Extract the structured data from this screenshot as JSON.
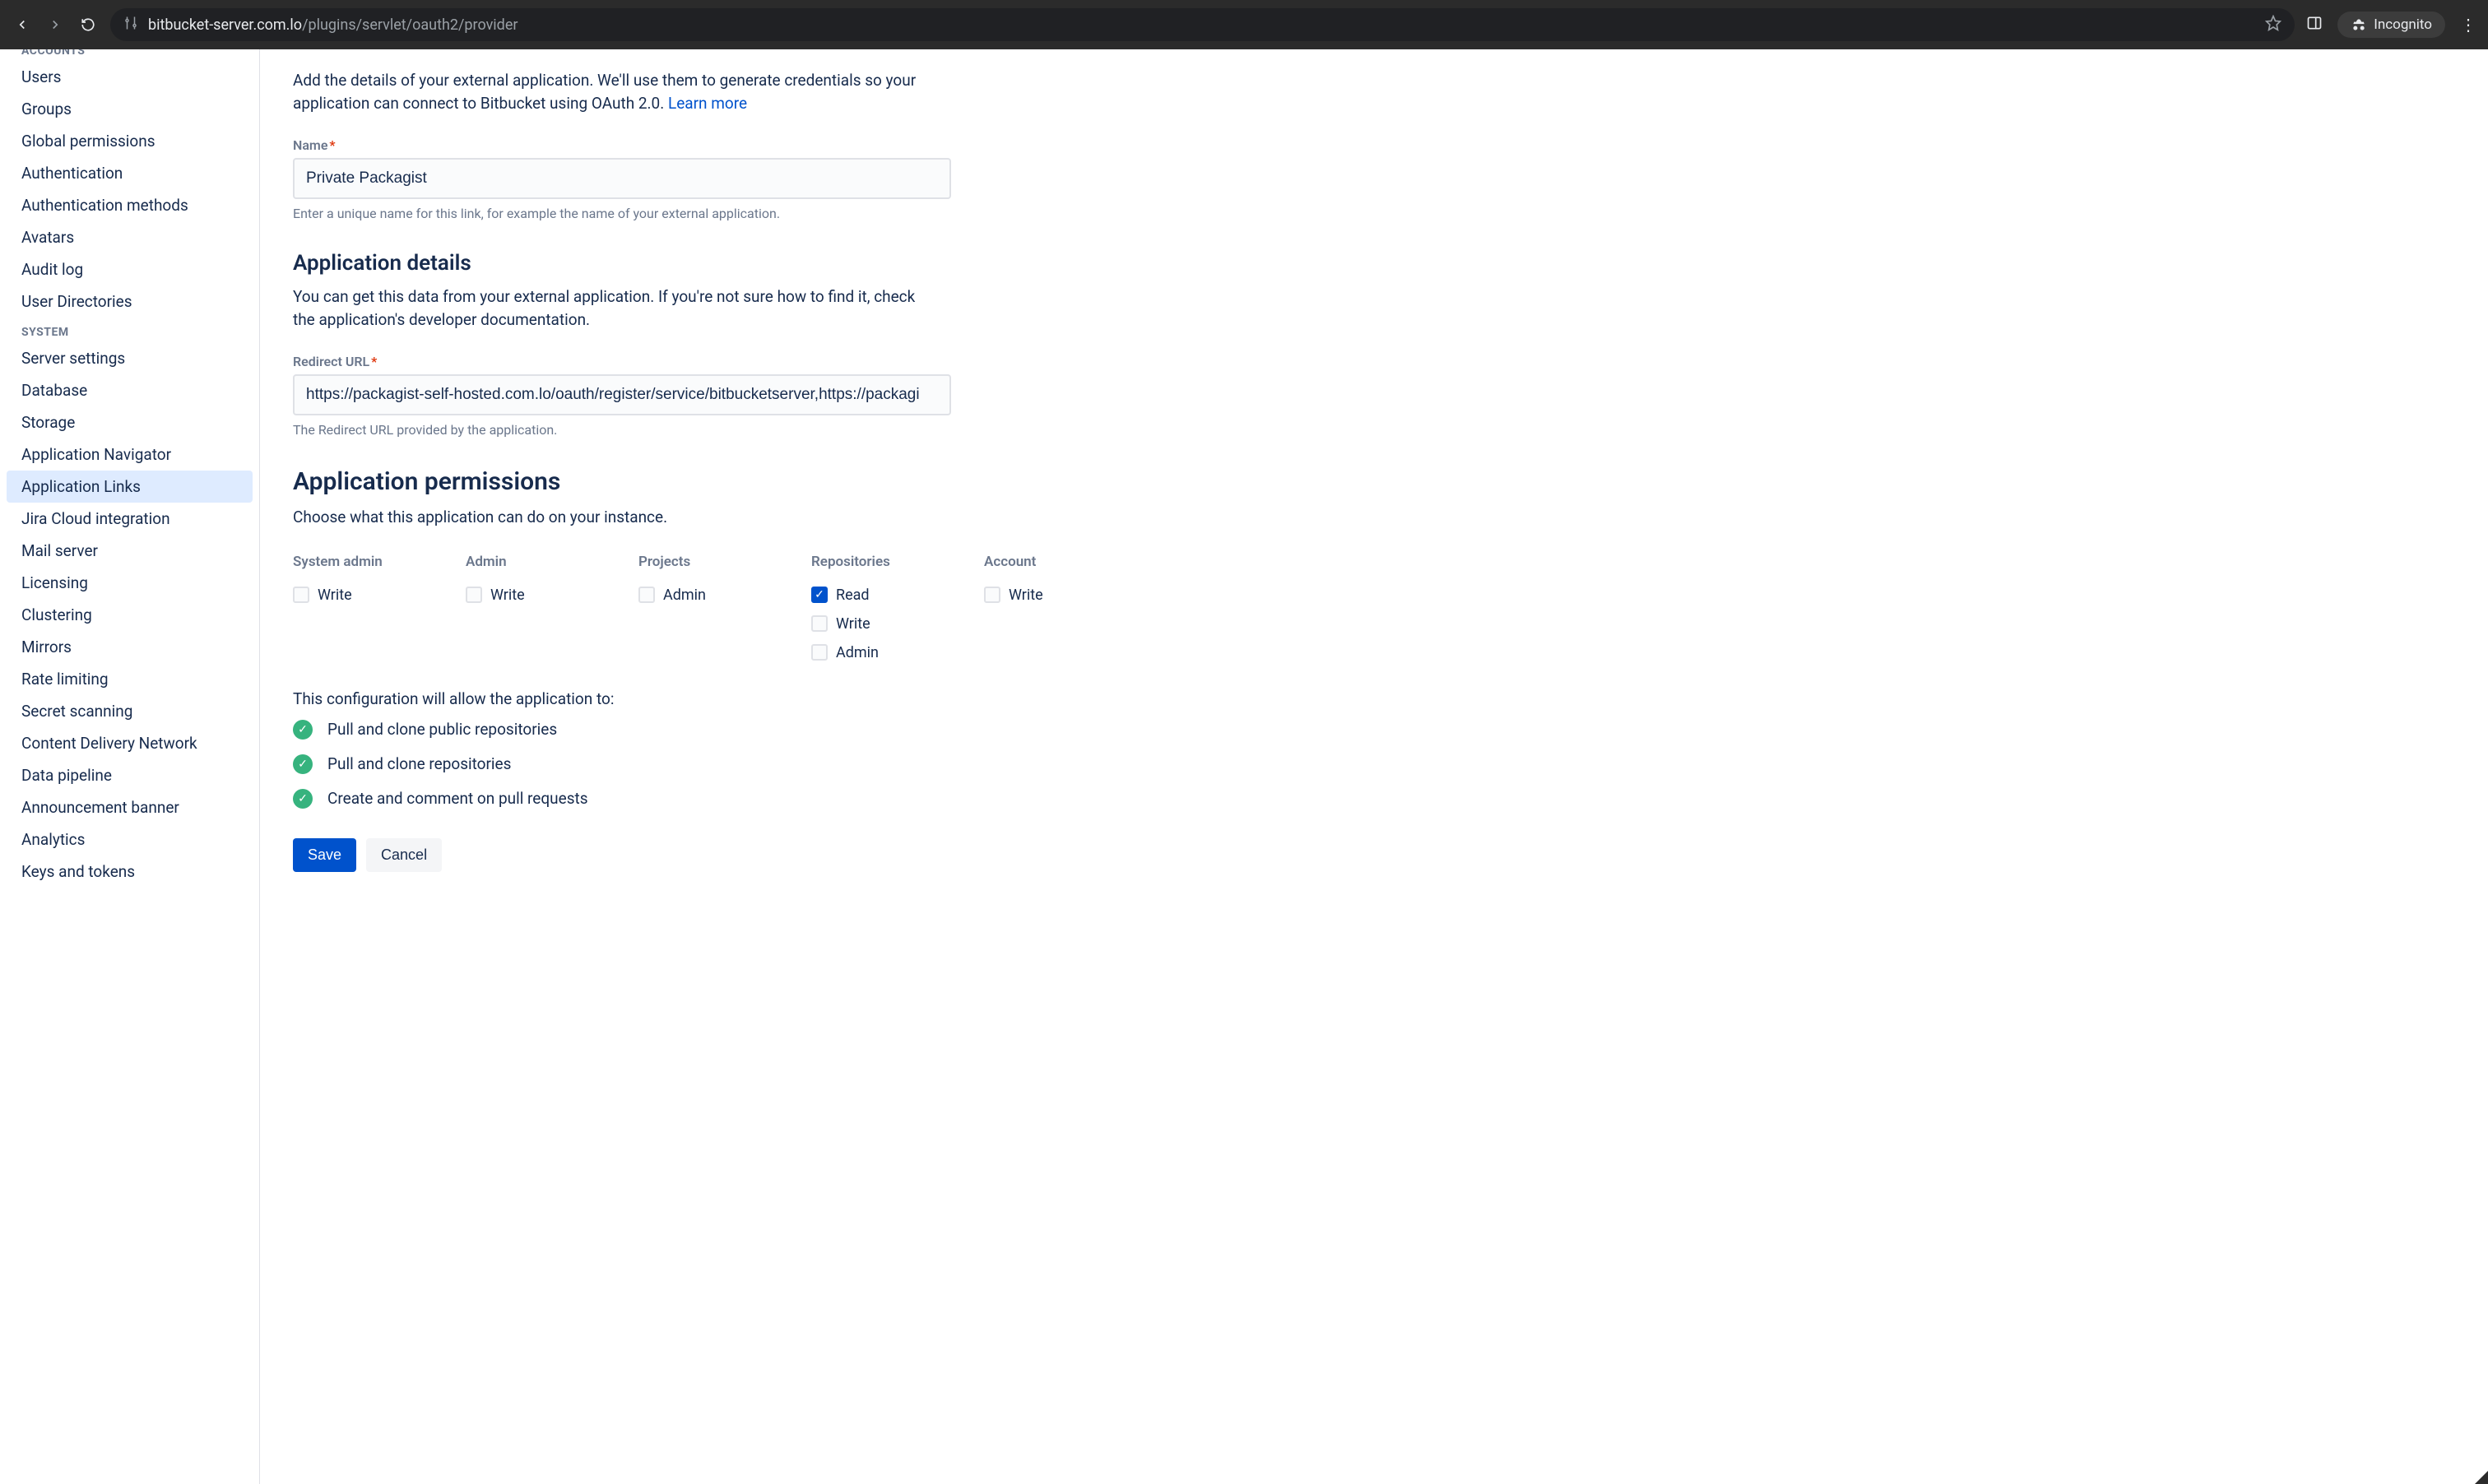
{
  "browser": {
    "url_host": "bitbucket-server.com.lo",
    "url_path": "/plugins/servlet/oauth2/provider",
    "incognito_label": "Incognito"
  },
  "sidebar": {
    "sections": [
      {
        "header": "ACCOUNTS",
        "clipped": true,
        "items": [
          {
            "label": "Users"
          },
          {
            "label": "Groups"
          },
          {
            "label": "Global permissions"
          },
          {
            "label": "Authentication"
          },
          {
            "label": "Authentication methods"
          },
          {
            "label": "Avatars"
          },
          {
            "label": "Audit log"
          },
          {
            "label": "User Directories"
          }
        ]
      },
      {
        "header": "SYSTEM",
        "items": [
          {
            "label": "Server settings"
          },
          {
            "label": "Database"
          },
          {
            "label": "Storage"
          },
          {
            "label": "Application Navigator"
          },
          {
            "label": "Application Links",
            "selected": true
          },
          {
            "label": "Jira Cloud integration"
          },
          {
            "label": "Mail server"
          },
          {
            "label": "Licensing"
          },
          {
            "label": "Clustering"
          },
          {
            "label": "Mirrors"
          },
          {
            "label": "Rate limiting"
          },
          {
            "label": "Secret scanning"
          },
          {
            "label": "Content Delivery Network"
          },
          {
            "label": "Data pipeline"
          },
          {
            "label": "Announcement banner"
          },
          {
            "label": "Analytics"
          },
          {
            "label": "Keys and tokens"
          }
        ]
      }
    ]
  },
  "main": {
    "intro_text": "Add the details of your external application. We'll use them to generate credentials so your application can connect to Bitbucket using OAuth 2.0. ",
    "learn_more": "Learn more",
    "name_field": {
      "label": "Name",
      "value": "Private Packagist",
      "help": "Enter a unique name for this link, for example the name of your external application."
    },
    "app_details": {
      "heading": "Application details",
      "desc": "You can get this data from your external application. If you're not sure how to find it, check the application's developer documentation.",
      "redirect_label": "Redirect URL",
      "redirect_value": "https://packagist-self-hosted.com.lo/oauth/register/service/bitbucketserver,https://packagi",
      "redirect_help": "The Redirect URL provided by the application."
    },
    "permissions": {
      "heading": "Application permissions",
      "desc": "Choose what this application can do on your instance.",
      "columns": [
        {
          "head": "System admin",
          "options": [
            {
              "label": "Write",
              "checked": false
            }
          ]
        },
        {
          "head": "Admin",
          "options": [
            {
              "label": "Write",
              "checked": false
            }
          ]
        },
        {
          "head": "Projects",
          "options": [
            {
              "label": "Admin",
              "checked": false
            }
          ]
        },
        {
          "head": "Repositories",
          "options": [
            {
              "label": "Read",
              "checked": true
            },
            {
              "label": "Write",
              "checked": false
            },
            {
              "label": "Admin",
              "checked": false
            }
          ]
        },
        {
          "head": "Account",
          "options": [
            {
              "label": "Write",
              "checked": false
            }
          ]
        }
      ]
    },
    "capabilities": {
      "intro": "This configuration will allow the application to:",
      "items": [
        "Pull and clone public repositories",
        "Pull and clone repositories",
        "Create and comment on pull requests"
      ]
    },
    "actions": {
      "save": "Save",
      "cancel": "Cancel"
    }
  }
}
